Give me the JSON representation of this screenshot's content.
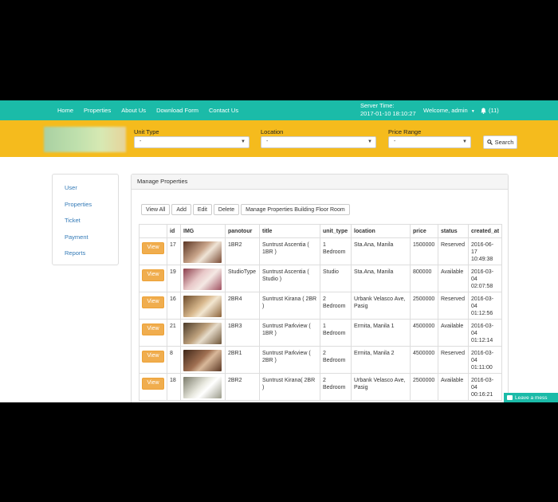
{
  "nav": {
    "links": [
      "Home",
      "Properties",
      "About Us",
      "Download Form",
      "Contact Us"
    ],
    "server_time_label": "Server Time:",
    "server_time_value": "2017-01-10 18:10:27",
    "welcome": "Welcome, admin",
    "notifications": "(11)"
  },
  "filters": {
    "unit_type_label": "Unit Type",
    "unit_type_value": "-",
    "location_label": "Location",
    "location_value": "-",
    "price_range_label": "Price Range",
    "price_range_value": "-",
    "search_label": "Search"
  },
  "sidebar": {
    "items": [
      "User",
      "Properties",
      "Ticket",
      "Payment",
      "Reports"
    ]
  },
  "panel": {
    "title": "Manage Properties",
    "buttons": [
      "View All",
      "Add",
      "Edit",
      "Delete",
      "Manage Properties Building Floor Room"
    ]
  },
  "table": {
    "headers": [
      "",
      "id",
      "IMG",
      "panotour",
      "title",
      "unit_type",
      "location",
      "price",
      "status",
      "created_at"
    ],
    "view_label": "View",
    "rows": [
      {
        "id": "17",
        "panotour": "1BR2",
        "title": "Suntrust Ascentia ( 1BR )",
        "unit_type": "1 Bedroom",
        "location": "Sta.Ana, Manila",
        "price": "1500000",
        "status": "Reserved",
        "created_at": "2016-06-17 10:49:38"
      },
      {
        "id": "19",
        "panotour": "StudioType",
        "title": "Suntrust Ascentia ( Studio )",
        "unit_type": "Studio",
        "location": "Sta.Ana, Manila",
        "price": "800000",
        "status": "Available",
        "created_at": "2016-03-04 02:07:58"
      },
      {
        "id": "16",
        "panotour": "2BR4",
        "title": "Suntrust Kirana ( 2BR )",
        "unit_type": "2 Bedroom",
        "location": "Urbank Velasco Ave, Pasig",
        "price": "2500000",
        "status": "Reserved",
        "created_at": "2016-03-04 01:12:56"
      },
      {
        "id": "21",
        "panotour": "1BR3",
        "title": "Suntrust Parkview ( 1BR )",
        "unit_type": "1 Bedroom",
        "location": "Ermita, Manila 1",
        "price": "4500000",
        "status": "Available",
        "created_at": "2016-03-04 01:12:14"
      },
      {
        "id": "8",
        "panotour": "2BR1",
        "title": "Suntrust Parkview ( 2BR )",
        "unit_type": "2 Bedroom",
        "location": "Ermita, Manila 2",
        "price": "4500000",
        "status": "Reserved",
        "created_at": "2016-03-04 01:11:00"
      },
      {
        "id": "18",
        "panotour": "2BR2",
        "title": "Suntrust Kirana( 2BR )",
        "unit_type": "2 Bedroom",
        "location": "Urbank Velasco Ave, Pasig",
        "price": "2500000",
        "status": "Available",
        "created_at": "2016-03-04 00:16:21"
      }
    ]
  },
  "chat": {
    "label": "Leave a mess"
  },
  "colors": {
    "navbar": "#1bbba8",
    "filterbar": "#f5bb1d",
    "view_button": "#f0ad4e",
    "link": "#337ab7"
  }
}
